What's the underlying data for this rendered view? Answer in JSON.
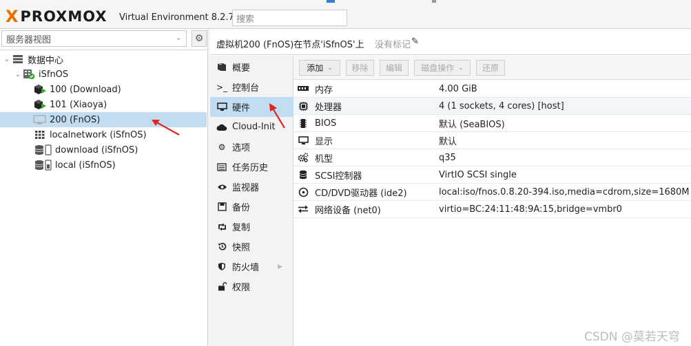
{
  "header": {
    "logo_x": "X",
    "logo_text": "PROXMOX",
    "version_text": "Virtual Environment 8.2.7",
    "search_placeholder": "搜索"
  },
  "tree": {
    "view_label": "服务器视图",
    "nodes": [
      {
        "label": "数据中心"
      },
      {
        "label": "iSfnOS"
      },
      {
        "label": "100 (Download)"
      },
      {
        "label": "101 (Xiaoya)"
      },
      {
        "label": "200 (FnOS)"
      },
      {
        "label": "localnetwork (iSfnOS)"
      },
      {
        "label": "download (iSfnOS)"
      },
      {
        "label": "local (iSfnOS)"
      }
    ]
  },
  "vm": {
    "title": "虚拟机200 (FnOS)在节点'iSfnOS'上",
    "tag_label": "没有标记"
  },
  "menu": {
    "items": [
      {
        "label": "概要"
      },
      {
        "label": "控制台"
      },
      {
        "label": "硬件"
      },
      {
        "label": "Cloud-Init"
      },
      {
        "label": "选项"
      },
      {
        "label": "任务历史"
      },
      {
        "label": "监视器"
      },
      {
        "label": "备份"
      },
      {
        "label": "复制"
      },
      {
        "label": "快照"
      },
      {
        "label": "防火墙"
      },
      {
        "label": "权限"
      }
    ]
  },
  "toolbar": {
    "add_label": "添加",
    "remove_label": "移除",
    "edit_label": "编辑",
    "disk_action_label": "磁盘操作",
    "revert_label": "还原"
  },
  "hardware": {
    "rows": [
      {
        "key": "内存",
        "value": "4.00 GiB"
      },
      {
        "key": "处理器",
        "value": "4 (1 sockets, 4 cores) [host]"
      },
      {
        "key": "BIOS",
        "value": "默认 (SeaBIOS)"
      },
      {
        "key": "显示",
        "value": "默认"
      },
      {
        "key": "机型",
        "value": "q35"
      },
      {
        "key": "SCSI控制器",
        "value": "VirtIO SCSI single"
      },
      {
        "key": "CD/DVD驱动器 (ide2)",
        "value": "local:iso/fnos.0.8.20-394.iso,media=cdrom,size=1680M"
      },
      {
        "key": "网络设备 (net0)",
        "value": "virtio=BC:24:11:48:9A:15,bridge=vmbr0"
      }
    ]
  },
  "watermark": "CSDN @莫若天穹",
  "colors": {
    "accent": "#e57000",
    "selection": "#c2ddf2",
    "running_green": "#2fa82f",
    "arrow_red": "#e0261f"
  }
}
